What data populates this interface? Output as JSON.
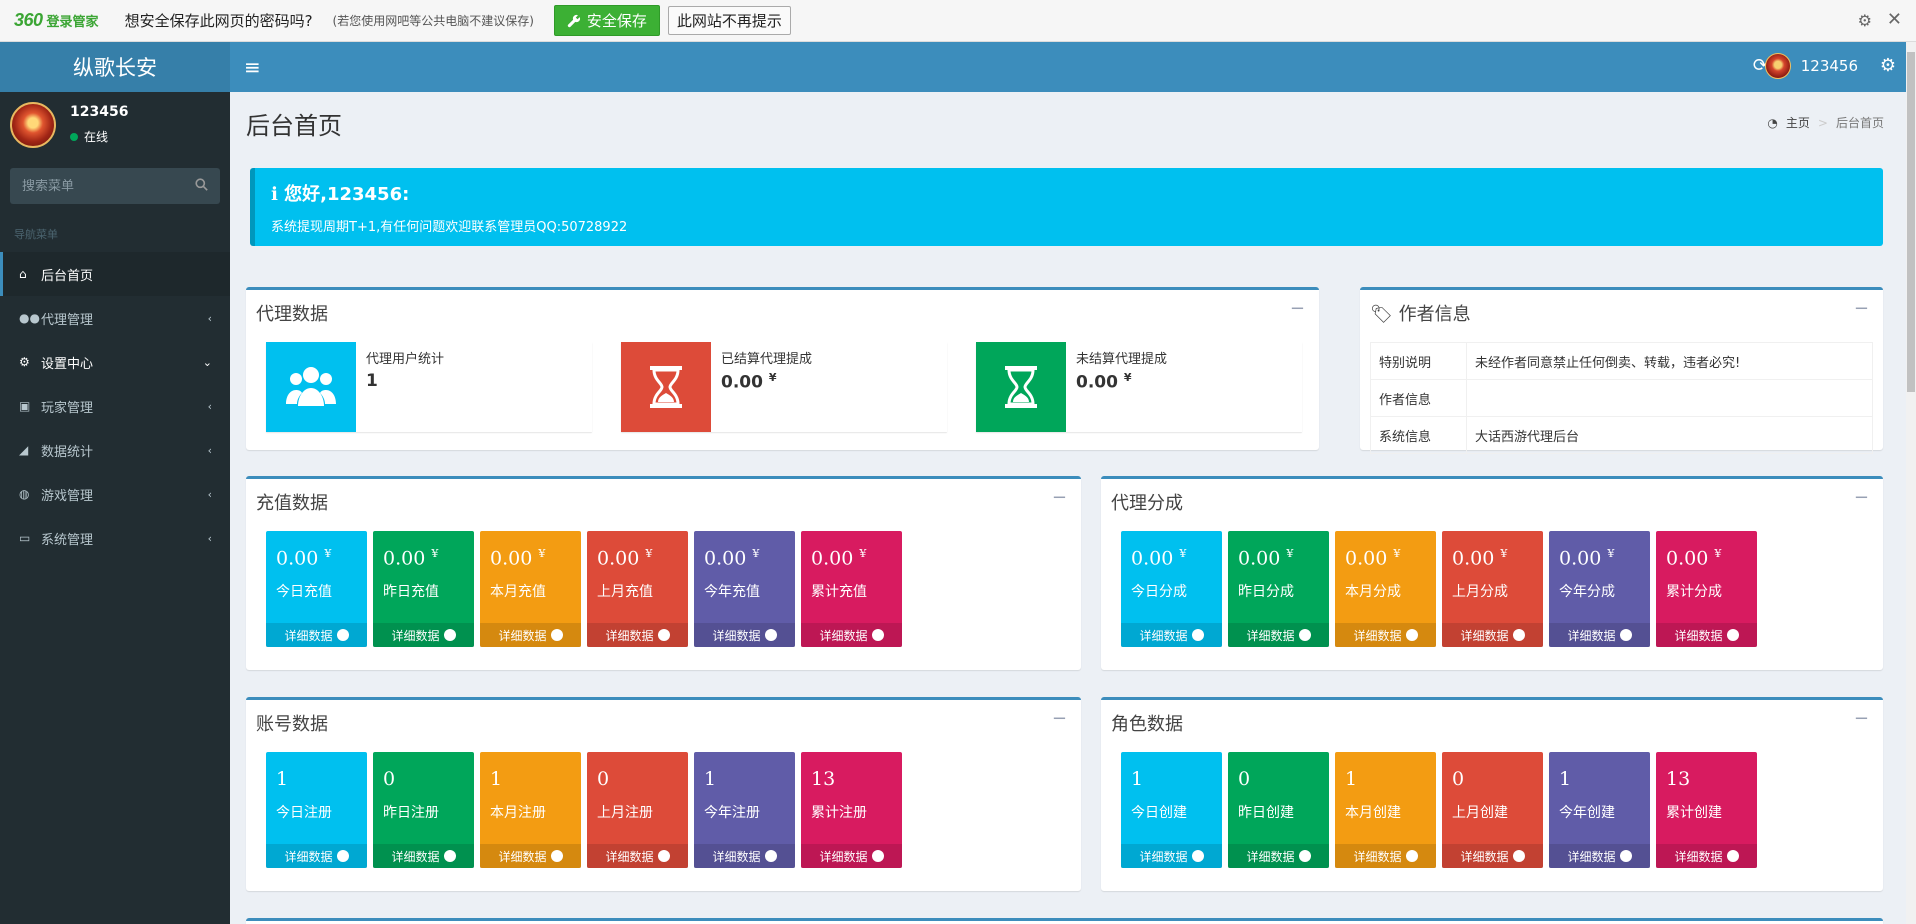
{
  "pwbar": {
    "brand": "360",
    "brand_sub": "登录管家",
    "question": "想安全保存此网页的密码吗?",
    "hint": "(若您使用网吧等公共电脑不建议保存)",
    "save_label": "安全保存",
    "nomore_label": "此网站不再提示"
  },
  "app": {
    "logo": "纵歌长安"
  },
  "header": {
    "username": "123456"
  },
  "sidebar": {
    "username": "123456",
    "status": "在线",
    "search_placeholder": "搜索菜单",
    "nav_header": "导航菜单",
    "items": [
      {
        "label": "后台首页",
        "icon": "home-icon",
        "active": true
      },
      {
        "label": "代理管理",
        "icon": "users-icon"
      },
      {
        "label": "设置中心",
        "icon": "cogs-icon",
        "open": true
      },
      {
        "label": "玩家管理",
        "icon": "user-card-icon"
      },
      {
        "label": "数据统计",
        "icon": "area-chart-icon"
      },
      {
        "label": "游戏管理",
        "icon": "gamepad-icon"
      },
      {
        "label": "系统管理",
        "icon": "desktop-icon"
      }
    ]
  },
  "page": {
    "title": "后台首页",
    "breadcrumb": {
      "home": "主页",
      "current": "后台首页"
    }
  },
  "callout": {
    "title": "您好,123456:",
    "text": "系统提现周期T+1,有任何问题欢迎联系管理员QQ:50728922"
  },
  "agent_box": {
    "title": "代理数据",
    "items": [
      {
        "label": "代理用户统计",
        "value": "1",
        "icon": "users-icon",
        "color": "#00c0ef"
      },
      {
        "label": "已结算代理提成",
        "value": "0.00",
        "unit": "¥",
        "icon": "hourglass-icon",
        "color": "#dd4b39"
      },
      {
        "label": "未结算代理提成",
        "value": "0.00",
        "unit": "¥",
        "icon": "hourglass-icon",
        "color": "#00a65a"
      }
    ]
  },
  "author_box": {
    "title": "作者信息",
    "rows": [
      {
        "key": "特别说明",
        "value": "未经作者同意禁止任何倒卖、转载，违者必究!"
      },
      {
        "key": "作者信息",
        "value": ""
      },
      {
        "key": "系统信息",
        "value": "大话西游代理后台"
      }
    ]
  },
  "detail_label": "详细数据",
  "recharge_box": {
    "title": "充值数据",
    "tiles": [
      {
        "value": "0.00",
        "unit": "¥",
        "label": "今日充值"
      },
      {
        "value": "0.00",
        "unit": "¥",
        "label": "昨日充值"
      },
      {
        "value": "0.00",
        "unit": "¥",
        "label": "本月充值"
      },
      {
        "value": "0.00",
        "unit": "¥",
        "label": "上月充值"
      },
      {
        "value": "0.00",
        "unit": "¥",
        "label": "今年充值"
      },
      {
        "value": "0.00",
        "unit": "¥",
        "label": "累计充值"
      }
    ]
  },
  "share_box": {
    "title": "代理分成",
    "tiles": [
      {
        "value": "0.00",
        "unit": "¥",
        "label": "今日分成"
      },
      {
        "value": "0.00",
        "unit": "¥",
        "label": "昨日分成"
      },
      {
        "value": "0.00",
        "unit": "¥",
        "label": "本月分成"
      },
      {
        "value": "0.00",
        "unit": "¥",
        "label": "上月分成"
      },
      {
        "value": "0.00",
        "unit": "¥",
        "label": "今年分成"
      },
      {
        "value": "0.00",
        "unit": "¥",
        "label": "累计分成"
      }
    ]
  },
  "account_box": {
    "title": "账号数据",
    "tiles": [
      {
        "value": "1",
        "label": "今日注册"
      },
      {
        "value": "0",
        "label": "昨日注册"
      },
      {
        "value": "1",
        "label": "本月注册"
      },
      {
        "value": "0",
        "label": "上月注册"
      },
      {
        "value": "1",
        "label": "今年注册"
      },
      {
        "value": "13",
        "label": "累计注册"
      }
    ]
  },
  "role_box": {
    "title": "角色数据",
    "tiles": [
      {
        "value": "1",
        "label": "今日创建"
      },
      {
        "value": "0",
        "label": "昨日创建"
      },
      {
        "value": "1",
        "label": "本月创建"
      },
      {
        "value": "0",
        "label": "上月创建"
      },
      {
        "value": "1",
        "label": "今年创建"
      },
      {
        "value": "13",
        "label": "累计创建"
      }
    ]
  },
  "tile_colors": [
    "#00c0ef",
    "#00a65a",
    "#f39c12",
    "#dd4b39",
    "#605ca8",
    "#d81b60"
  ]
}
